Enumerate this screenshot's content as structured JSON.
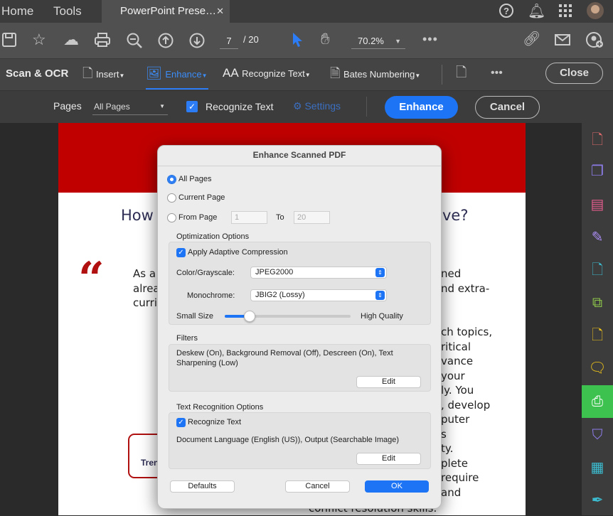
{
  "menubar": {
    "home": "Home",
    "tools": "Tools",
    "doc_tab": "PowerPoint Prese…",
    "close_tab": "✕"
  },
  "toolbar": {
    "page_current": "7",
    "page_sep": "/ 20",
    "zoom": "70.2%"
  },
  "subbar": {
    "title": "Scan & OCR",
    "insert": "Insert",
    "enhance": "Enhance",
    "recognize_text": "Recognize Text",
    "bates": "Bates Numbering",
    "close": "Close"
  },
  "optbar": {
    "pages_label": "Pages",
    "pages_value": "All Pages",
    "recognize_text": "Recognize Text",
    "settings": "Settings",
    "enhance": "Enhance",
    "cancel": "Cancel"
  },
  "document": {
    "heading_left": "How",
    "heading_right": "ve?",
    "lines_left": [
      "As a s",
      "alrea",
      "curric"
    ],
    "lines_right": [
      "ned",
      "nd extra-"
    ],
    "col_right": [
      "ch topics,",
      "ritical",
      "vance",
      "your",
      "ly. You",
      ", develop",
      "puter",
      "s",
      "ty.",
      "plete",
      "require",
      "and"
    ],
    "bottom_line": "conflict resolution skills.",
    "card_text": "Tren"
  },
  "dialog": {
    "title": "Enhance Scanned PDF",
    "all_pages": "All Pages",
    "current_page": "Current Page",
    "from_page": "From Page",
    "from_value": "1",
    "to_label": "To",
    "to_value": "20",
    "opt_section": "Optimization Options",
    "adaptive": "Apply Adaptive Compression",
    "color_label": "Color/Grayscale:",
    "color_value": "JPEG2000",
    "mono_label": "Monochrome:",
    "mono_value": "JBIG2 (Lossy)",
    "small": "Small Size",
    "high": "High Quality",
    "slider_level": 0.2,
    "filters_section": "Filters",
    "filters_text": "Deskew (On), Background Removal (Off), Descreen (On), Text Sharpening (Low)",
    "edit": "Edit",
    "text_section": "Text Recognition Options",
    "recognize": "Recognize Text",
    "doc_lang": "Document Language (English (US)), Output (Searchable Image)",
    "defaults": "Defaults",
    "cancel": "Cancel",
    "ok": "OK"
  },
  "colors": {
    "accent": "#1d74f5",
    "brand_red": "#c00000",
    "green_active": "#3ec24f"
  }
}
